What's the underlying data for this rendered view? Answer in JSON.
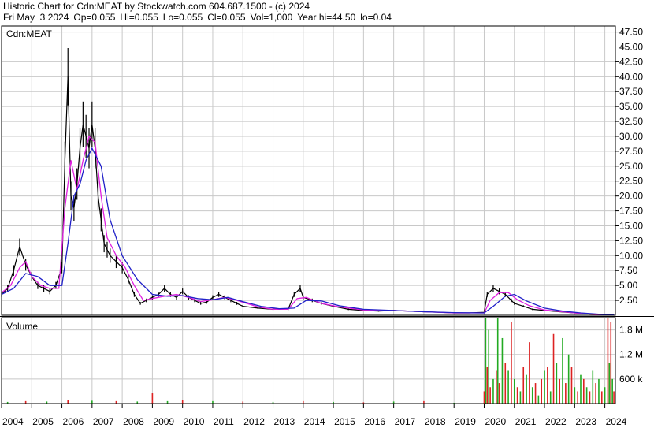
{
  "header": {
    "title": "Historic Chart for Cdn:MEAT by Stockwatch.com 604.687.1500 - (c) 2024",
    "date": "Fri May  3 2024",
    "open": "Op=0.055",
    "high": "Hi=0.055",
    "low": "Lo=0.055",
    "close": "Cl=0.055",
    "volume": "Vol=1,000",
    "year_high": "Year hi=44.50",
    "year_low": "lo=0.04"
  },
  "chart_data": [
    {
      "type": "line",
      "title": "Cdn:MEAT",
      "ylim": [
        0,
        48.5
      ],
      "y_ticks": [
        "47.50",
        "45.00",
        "42.50",
        "40.00",
        "37.50",
        "35.00",
        "32.50",
        "30.00",
        "27.50",
        "25.00",
        "22.50",
        "20.00",
        "17.50",
        "15.00",
        "12.50",
        "10.00",
        "7.50",
        "5.00",
        "2.50"
      ],
      "y_tick_values": [
        47.5,
        45,
        42.5,
        40,
        37.5,
        35,
        32.5,
        30,
        27.5,
        25,
        22.5,
        20,
        17.5,
        15,
        12.5,
        10,
        7.5,
        5,
        2.5
      ],
      "x_ticks": [
        "2004",
        "2005",
        "2006",
        "2007",
        "2008",
        "2009",
        "2010",
        "2011",
        "2012",
        "2013",
        "2014",
        "2015",
        "2016",
        "2017",
        "2018",
        "2019",
        "2020",
        "2021",
        "2022",
        "2023",
        "2024"
      ],
      "x_tick_values": [
        2004,
        2005,
        2006,
        2007,
        2008,
        2009,
        2010,
        2011,
        2012,
        2013,
        2014,
        2015,
        2016,
        2017,
        2018,
        2019,
        2020,
        2021,
        2022,
        2023,
        2024
      ],
      "xlim": [
        2004.0,
        2024.35
      ],
      "grid": true,
      "series": [
        {
          "style": "high-low bars",
          "color": "#000000",
          "x": [
            2004.0,
            2004.2,
            2004.4,
            2004.6,
            2004.8,
            2005.0,
            2005.2,
            2005.4,
            2005.6,
            2005.8,
            2006.0,
            2006.1,
            2006.2,
            2006.3,
            2006.4,
            2006.5,
            2006.6,
            2006.7,
            2006.8,
            2006.9,
            2007.0,
            2007.1,
            2007.2,
            2007.3,
            2007.4,
            2007.5,
            2007.6,
            2007.8,
            2008.0,
            2008.2,
            2008.4,
            2008.6,
            2008.8,
            2009.0,
            2009.2,
            2009.4,
            2009.6,
            2009.8,
            2010.0,
            2010.2,
            2010.4,
            2010.6,
            2010.8,
            2011.0,
            2011.2,
            2011.4,
            2011.6,
            2011.8,
            2012.0,
            2012.5,
            2013.0,
            2013.5,
            2013.7,
            2013.9,
            2014.0,
            2014.3,
            2014.6,
            2015.0,
            2015.5,
            2016.0,
            2016.5,
            2017.0,
            2017.5,
            2018.0,
            2018.5,
            2019.0,
            2019.5,
            2020.0,
            2020.1,
            2020.3,
            2020.5,
            2020.7,
            2020.9,
            2021.0,
            2021.3,
            2021.6,
            2022.0,
            2022.5,
            2023.0,
            2023.5,
            2024.0,
            2024.3
          ],
          "y": [
            3.5,
            4.5,
            7.5,
            11.5,
            8.5,
            6.5,
            5.0,
            4.5,
            4.0,
            5.0,
            8.0,
            26.0,
            40.0,
            20.0,
            18.0,
            22.0,
            28.0,
            32.0,
            30.0,
            28.0,
            32.0,
            28.0,
            20.0,
            16.0,
            12.0,
            11.0,
            10.0,
            9.0,
            8.0,
            6.0,
            3.5,
            2.0,
            2.5,
            3.0,
            3.5,
            4.5,
            3.5,
            3.0,
            4.0,
            3.0,
            2.5,
            2.0,
            2.2,
            3.0,
            3.5,
            3.0,
            2.5,
            2.0,
            1.5,
            1.2,
            1.0,
            1.0,
            3.5,
            4.5,
            3.0,
            2.5,
            2.0,
            1.5,
            1.0,
            0.8,
            0.7,
            0.8,
            0.7,
            0.6,
            0.5,
            0.4,
            0.4,
            0.5,
            3.5,
            4.5,
            4.0,
            3.5,
            2.5,
            2.0,
            1.5,
            1.0,
            0.8,
            0.6,
            0.4,
            0.2,
            0.1,
            0.06
          ]
        },
        {
          "style": "moving average (short)",
          "color": "#e020e0",
          "x": [
            2004.0,
            2004.3,
            2004.6,
            2004.8,
            2005.0,
            2005.3,
            2005.6,
            2005.9,
            2006.1,
            2006.3,
            2006.5,
            2006.7,
            2006.9,
            2007.1,
            2007.3,
            2007.5,
            2007.8,
            2008.1,
            2008.4,
            2008.7,
            2009.0,
            2009.4,
            2009.8,
            2010.2,
            2010.6,
            2011.0,
            2011.4,
            2011.8,
            2012.5,
            2013.0,
            2013.5,
            2013.8,
            2014.1,
            2014.6,
            2015.2,
            2016.0,
            2017.0,
            2018.0,
            2019.0,
            2020.0,
            2020.2,
            2020.5,
            2020.8,
            2021.1,
            2021.5,
            2022.0,
            2022.6,
            2023.2,
            2023.8,
            2024.3
          ],
          "y": [
            3.8,
            5.0,
            8.0,
            9.0,
            6.5,
            5.0,
            4.5,
            4.5,
            18.0,
            26.0,
            21.0,
            26.0,
            30.0,
            29.0,
            20.0,
            13.0,
            10.0,
            8.0,
            5.0,
            2.5,
            2.8,
            3.2,
            3.5,
            3.0,
            2.3,
            2.6,
            3.0,
            2.5,
            1.4,
            1.0,
            1.0,
            2.8,
            3.0,
            2.0,
            1.4,
            0.9,
            0.8,
            0.6,
            0.4,
            0.4,
            2.5,
            3.8,
            3.8,
            2.6,
            1.6,
            0.9,
            0.6,
            0.3,
            0.12,
            0.07
          ]
        },
        {
          "style": "moving average (long)",
          "color": "#2020c8",
          "x": [
            2004.0,
            2004.4,
            2004.8,
            2005.2,
            2005.6,
            2006.0,
            2006.2,
            2006.4,
            2006.6,
            2006.8,
            2007.0,
            2007.3,
            2007.6,
            2008.0,
            2008.5,
            2009.0,
            2009.5,
            2010.0,
            2010.5,
            2011.0,
            2011.5,
            2012.0,
            2012.6,
            2013.2,
            2013.7,
            2014.1,
            2014.6,
            2015.2,
            2016.0,
            2017.0,
            2018.0,
            2019.0,
            2020.0,
            2020.3,
            2020.7,
            2021.0,
            2021.4,
            2022.0,
            2022.6,
            2023.2,
            2023.8,
            2024.3
          ],
          "y": [
            3.5,
            4.5,
            7.0,
            6.5,
            5.0,
            5.0,
            12.0,
            20.0,
            22.0,
            26.0,
            28.0,
            25.0,
            16.0,
            10.0,
            6.0,
            3.5,
            3.2,
            3.3,
            2.8,
            2.6,
            3.0,
            2.3,
            1.5,
            1.1,
            1.2,
            2.5,
            2.4,
            1.6,
            1.0,
            0.8,
            0.6,
            0.45,
            0.4,
            1.5,
            3.2,
            3.5,
            2.4,
            1.2,
            0.7,
            0.4,
            0.18,
            0.1
          ]
        }
      ]
    },
    {
      "type": "bar",
      "title": "Volume",
      "y_ticks": [
        "1.8 M",
        "1.2 M",
        "600 k"
      ],
      "y_tick_values": [
        1800000,
        1200000,
        600000
      ],
      "ylim": [
        0,
        2100000
      ],
      "series": [
        {
          "name": "",
          "colors": [
            "#22aa22",
            "#dd2222"
          ],
          "x": [
            2004.2,
            2004.8,
            2005.5,
            2006.2,
            2007.0,
            2007.8,
            2008.5,
            2009.0,
            2009.5,
            2010.0,
            2011.0,
            2012.0,
            2013.0,
            2014.0,
            2015.0,
            2016.0,
            2017.0,
            2018.0,
            2019.0,
            2020.0,
            2020.05,
            2020.1,
            2020.15,
            2020.2,
            2020.3,
            2020.4,
            2020.45,
            2020.5,
            2020.6,
            2020.7,
            2020.8,
            2020.9,
            2021.0,
            2021.1,
            2021.2,
            2021.3,
            2021.4,
            2021.5,
            2021.6,
            2021.7,
            2021.8,
            2021.9,
            2022.0,
            2022.1,
            2022.2,
            2022.3,
            2022.4,
            2022.5,
            2022.6,
            2022.7,
            2022.8,
            2022.9,
            2023.0,
            2023.1,
            2023.2,
            2023.3,
            2023.4,
            2023.5,
            2023.6,
            2023.7,
            2023.8,
            2023.9,
            2024.0,
            2024.1,
            2024.15,
            2024.2,
            2024.25,
            2024.3
          ],
          "y": [
            40000,
            60000,
            50000,
            80000,
            70000,
            60000,
            50000,
            250000,
            60000,
            80000,
            60000,
            50000,
            40000,
            60000,
            40000,
            30000,
            50000,
            60000,
            20000,
            300000,
            2100000,
            900000,
            1800000,
            400000,
            600000,
            800000,
            2100000,
            500000,
            1600000,
            1000000,
            800000,
            2000000,
            600000,
            400000,
            300000,
            900000,
            700000,
            1500000,
            400000,
            500000,
            200000,
            600000,
            800000,
            900000,
            300000,
            1700000,
            1000000,
            600000,
            1600000,
            500000,
            1200000,
            900000,
            400000,
            300000,
            700000,
            600000,
            400000,
            300000,
            800000,
            500000,
            600000,
            300000,
            400000,
            2100000,
            1000000,
            2000000,
            600000,
            300000
          ]
        }
      ]
    }
  ]
}
